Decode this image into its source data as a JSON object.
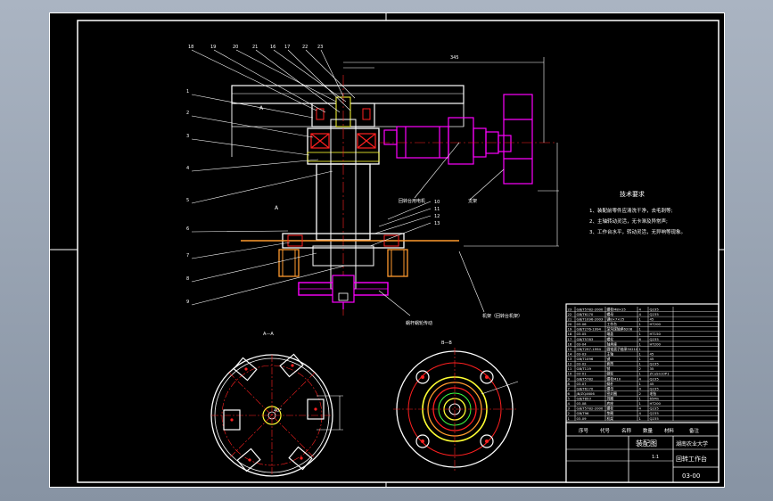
{
  "tech": {
    "title": "技术要求",
    "items": [
      "1、装配前零件应清洗干净，去毛刺等;",
      "2、主轴转动灵活，无卡滞及异常声;",
      "3、工作台水平，转动灵活，无异响等现象。"
    ]
  },
  "views": {
    "section_a": "A—A",
    "section_b": "B—B",
    "angle": "40°",
    "dim_top": "345",
    "dim_a": "A"
  },
  "callouts": {
    "top": [
      "18",
      "19",
      "20",
      "21",
      "16",
      "17",
      "22",
      "23"
    ],
    "left": [
      "1",
      "2",
      "3",
      "4",
      "5",
      "6",
      "7",
      "8",
      "9"
    ],
    "right": [
      "10",
      "11",
      "12",
      "13"
    ],
    "pink_label": "回转台用电机",
    "white_label": "支架",
    "bottom_label": "蜗杆蜗轮传动",
    "bottom_label2": "机架（回转台机架）"
  },
  "title_block": {
    "drawing_name": "装配图",
    "school": "湖南农业大学",
    "product": "回转工作台",
    "drawing_no": "03-00",
    "scale": "1:1",
    "col_headers": [
      "序号",
      "代号",
      "名称",
      "数量",
      "材料",
      "备注"
    ],
    "rows": [
      [
        "23",
        "GB/T5782-2000",
        "螺栓M8×25",
        "4",
        "Q235",
        ""
      ],
      [
        "22",
        "GB/T6170",
        "螺母",
        "4",
        "Q235",
        ""
      ],
      [
        "21",
        "GB/T1096-2003",
        "键8×7×25",
        "1",
        "45",
        ""
      ],
      [
        "20",
        "03-06",
        "工作台",
        "1",
        "HT200",
        ""
      ],
      [
        "19",
        "GB/T276-1994",
        "深沟球轴承6208",
        "1",
        "",
        ""
      ],
      [
        "18",
        "03-05",
        "端盖",
        "1",
        "HT150",
        ""
      ],
      [
        "17",
        "GB/T5783",
        "螺栓",
        "6",
        "Q235",
        ""
      ],
      [
        "16",
        "03-04",
        "轴承座",
        "1",
        "HT200",
        ""
      ],
      [
        "15",
        "GB/T297-1994",
        "圆锥滚子轴承30210",
        "1",
        "",
        ""
      ],
      [
        "14",
        "03-03",
        "主轴",
        "1",
        "45",
        ""
      ],
      [
        "13",
        "GB/T1096",
        "键",
        "1",
        "45",
        ""
      ],
      [
        "12",
        "03-02",
        "套筒",
        "1",
        "Q235",
        ""
      ],
      [
        "11",
        "GB/T119",
        "销",
        "2",
        "35",
        ""
      ],
      [
        "10",
        "03-01",
        "蜗轮",
        "1",
        "ZCuSn10P1",
        ""
      ],
      [
        "9",
        "GB/T5782",
        "螺栓M10",
        "4",
        "Q235",
        ""
      ],
      [
        "8",
        "03-07",
        "蜗杆",
        "1",
        "45",
        ""
      ],
      [
        "7",
        "GB/T6170",
        "螺母",
        "4",
        "Q235",
        ""
      ],
      [
        "6",
        "JB/ZQ4606",
        "密封圈",
        "2",
        "毛毡",
        ""
      ],
      [
        "5",
        "GB/T893",
        "挡圈",
        "1",
        "65Mn",
        ""
      ],
      [
        "4",
        "03-08",
        "底座",
        "1",
        "HT200",
        ""
      ],
      [
        "3",
        "GB/T5782-2000",
        "螺栓",
        "4",
        "Q235",
        ""
      ],
      [
        "2",
        "GB/T96",
        "垫圈",
        "4",
        "Q235",
        ""
      ],
      [
        "1",
        "03-09",
        "机架",
        "1",
        "Q235",
        ""
      ]
    ]
  },
  "colors": {
    "line": "#ffffff",
    "magenta": "#ff00ff",
    "red": "#ff2020",
    "yellow": "#ffff33",
    "orange": "#ff9a2e",
    "green": "#40ff40",
    "background": "#000000"
  }
}
